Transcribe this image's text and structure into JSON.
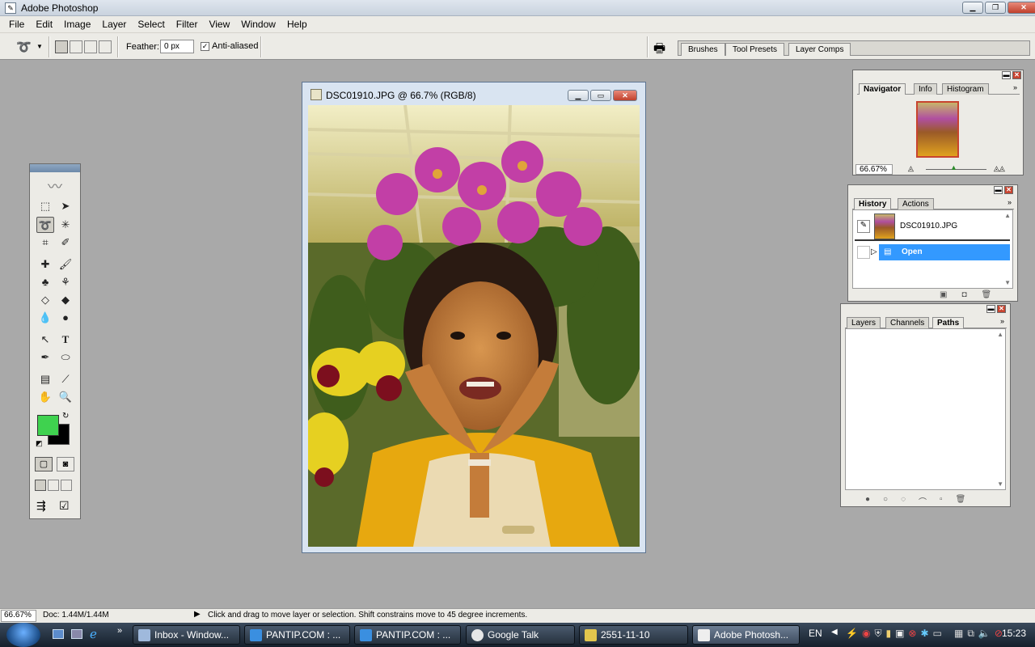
{
  "app": {
    "title": "Adobe Photoshop"
  },
  "menu": [
    "File",
    "Edit",
    "Image",
    "Layer",
    "Select",
    "Filter",
    "View",
    "Window",
    "Help"
  ],
  "options": {
    "feather_label": "Feather:",
    "feather_value": "0 px",
    "antialias_label": "Anti-aliased",
    "antialias_checked": true,
    "well_tabs": [
      "Brushes",
      "Tool Presets",
      "Layer Comps"
    ]
  },
  "document": {
    "title": "DSC01910.JPG @ 66.7% (RGB/8)"
  },
  "colors": {
    "foreground": "#3fd24f",
    "background": "#000000",
    "accent_selection": "#3399ff"
  },
  "navigator": {
    "tabs": [
      "Navigator",
      "Info",
      "Histogram"
    ],
    "zoom": "66.67%"
  },
  "history": {
    "tabs": [
      "History",
      "Actions"
    ],
    "snapshot": "DSC01910.JPG",
    "states": [
      "Open"
    ]
  },
  "layers": {
    "tabs": [
      "Layers",
      "Channels",
      "Paths"
    ]
  },
  "status": {
    "zoom": "66.67%",
    "doc": "Doc: 1.44M/1.44M",
    "hint": "Click and drag to move layer or selection. Shift constrains move to 45 degree increments."
  },
  "taskbar": {
    "items": [
      "Inbox - Window...",
      "PANTIP.COM : ...",
      "PANTIP.COM : ...",
      "Google Talk",
      "2551-11-10",
      "Adobe Photosh..."
    ],
    "lang": "EN",
    "clock": "15:23"
  }
}
